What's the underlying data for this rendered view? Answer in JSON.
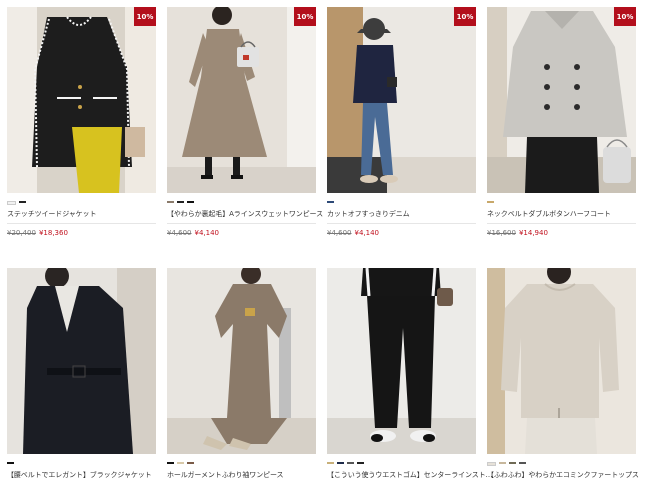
{
  "products": [
    {
      "name": "ステッチツイードジャケット",
      "badge": "10%",
      "old_price": "¥20,400",
      "new_price": "¥18,360",
      "swatches": [
        "#f2f2f2",
        "#222222"
      ],
      "scene": "tweed"
    },
    {
      "name": "【やわらか裏起毛】Aラインスウェットワンピース",
      "badge": "10%",
      "old_price": "¥4,600",
      "new_price": "¥4,140",
      "swatches": [
        "#8b7b6b",
        "#222222",
        "#111111"
      ],
      "scene": "aline"
    },
    {
      "name": "カットオフすっきりデニム",
      "badge": "10%",
      "old_price": "¥4,600",
      "new_price": "¥4,140",
      "swatches": [
        "#2e4a78"
      ],
      "scene": "denim"
    },
    {
      "name": "ネックベルトダブルボタンハーフコート",
      "badge": "10%",
      "old_price": "¥16,600",
      "new_price": "¥14,940",
      "swatches": [
        "#c8a86a"
      ],
      "scene": "coat"
    },
    {
      "name": "【腰ベルトでエレガント】ブラックジャケット",
      "badge": "",
      "old_price": "",
      "new_price": "",
      "swatches": [
        "#111111"
      ],
      "scene": "blackjacket"
    },
    {
      "name": "ホールガーメントふわり袖ワンピース",
      "badge": "",
      "old_price": "",
      "new_price": "",
      "swatches": [
        "#111111",
        "#d8c9a8",
        "#7a5b48"
      ],
      "scene": "knitdress"
    },
    {
      "name": "【こういう使うウエストゴム】センターラインスト…",
      "badge": "",
      "old_price": "",
      "new_price": "",
      "swatches": [
        "#c8b07a",
        "#1d2a4a",
        "#555555",
        "#222222"
      ],
      "scene": "pants"
    },
    {
      "name": "【ふわふわ】やわらかエコミンクファートップス",
      "badge": "",
      "old_price": "",
      "new_price": "",
      "swatches": [
        "#e6e1d8",
        "#c7b79c",
        "#6f6a55",
        "#555555"
      ],
      "scene": "fleece"
    }
  ]
}
